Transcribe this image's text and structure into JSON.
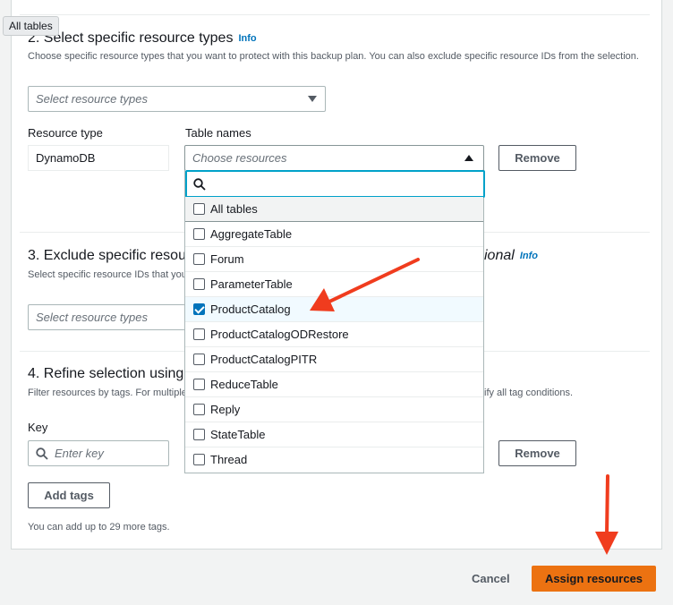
{
  "tooltip": "All tables",
  "section2": {
    "title": "2. Select specific resource types",
    "info": "Info",
    "description": "Choose specific resource types that you want to protect with this backup plan. You can also exclude specific resource IDs from the selection.",
    "select_placeholder": "Select resource types",
    "resource_type_label": "Resource type",
    "resource_type_value": "DynamoDB",
    "table_names_label": "Table names",
    "table_names_placeholder": "Choose resources",
    "remove_label": "Remove"
  },
  "section3": {
    "title_visible": "3. Exclude specific resou",
    "title_tail": "ional",
    "info": "Info",
    "description_visible": "Select specific resource IDs that you",
    "select_placeholder": "Select resource types"
  },
  "section4": {
    "title_visible": "4. Refine selection using",
    "description_visible": "Filter resources by tags. For multiple",
    "description_tail": "ify all tag conditions.",
    "key_label": "Key",
    "key_placeholder": "Enter key",
    "remove_label": "Remove",
    "add_tags_label": "Add tags",
    "note": "You can add up to 29 more tags."
  },
  "dropdown": {
    "search_value": "",
    "options": [
      {
        "label": "All tables",
        "checked": false
      },
      {
        "label": "AggregateTable",
        "checked": false
      },
      {
        "label": "Forum",
        "checked": false
      },
      {
        "label": "ParameterTable",
        "checked": false
      },
      {
        "label": "ProductCatalog",
        "checked": true
      },
      {
        "label": "ProductCatalogODRestore",
        "checked": false
      },
      {
        "label": "ProductCatalogPITR",
        "checked": false
      },
      {
        "label": "ReduceTable",
        "checked": false
      },
      {
        "label": "Reply",
        "checked": false
      },
      {
        "label": "StateTable",
        "checked": false
      },
      {
        "label": "Thread",
        "checked": false
      }
    ]
  },
  "footer": {
    "cancel_label": "Cancel",
    "assign_label": "Assign resources"
  },
  "colors": {
    "primary": "#ec7211",
    "link": "#0073bb",
    "focus": "#00a1c9",
    "annotation_arrow": "#f03c1e"
  }
}
